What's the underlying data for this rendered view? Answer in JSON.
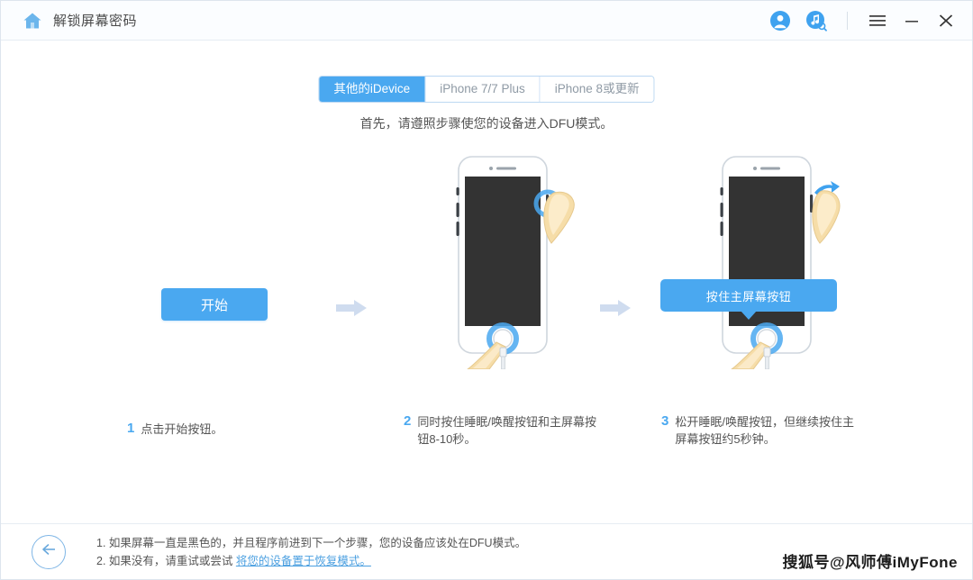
{
  "titlebar": {
    "home_icon": "home-icon",
    "app_title": "解锁屏幕密码",
    "account_icon": "account-icon",
    "music_search_icon": "music-search-icon",
    "menu_icon": "hamburger-menu-icon",
    "minimize_icon": "minimize-icon",
    "close_icon": "close-icon"
  },
  "tabs": [
    {
      "label": "其他的iDevice",
      "active": true
    },
    {
      "label": "iPhone 7/7 Plus",
      "active": false
    },
    {
      "label": "iPhone 8或更新",
      "active": false
    }
  ],
  "subtitle": "首先，请遵照步骤使您的设备进入DFU模式。",
  "start_button": "开始",
  "tooltip": "按住主屏幕按钮",
  "steps": [
    {
      "num": "1",
      "text": "点击开始按钮。"
    },
    {
      "num": "2",
      "text": "同时按住睡眠/唤醒按钮和主屏幕按钮8-10秒。"
    },
    {
      "num": "3",
      "text": "松开睡眠/唤醒按钮，但继续按住主屏幕按钮约5秒钟。"
    }
  ],
  "footer": {
    "back_icon": "back-arrow-icon",
    "note1": "1. 如果屏幕一直是黑色的，并且程序前进到下一个步骤，您的设备应该处在DFU模式。",
    "note2_prefix": "2. 如果没有，请重试或尝试 ",
    "note2_link": "将您的设备置于恢复模式。",
    "watermark": "搜狐号@风师傅iMyFone"
  },
  "colors": {
    "accent": "#4aa8f0",
    "arrow": "#cfdcef",
    "screen": "#333333",
    "link": "#4a9fe0"
  }
}
